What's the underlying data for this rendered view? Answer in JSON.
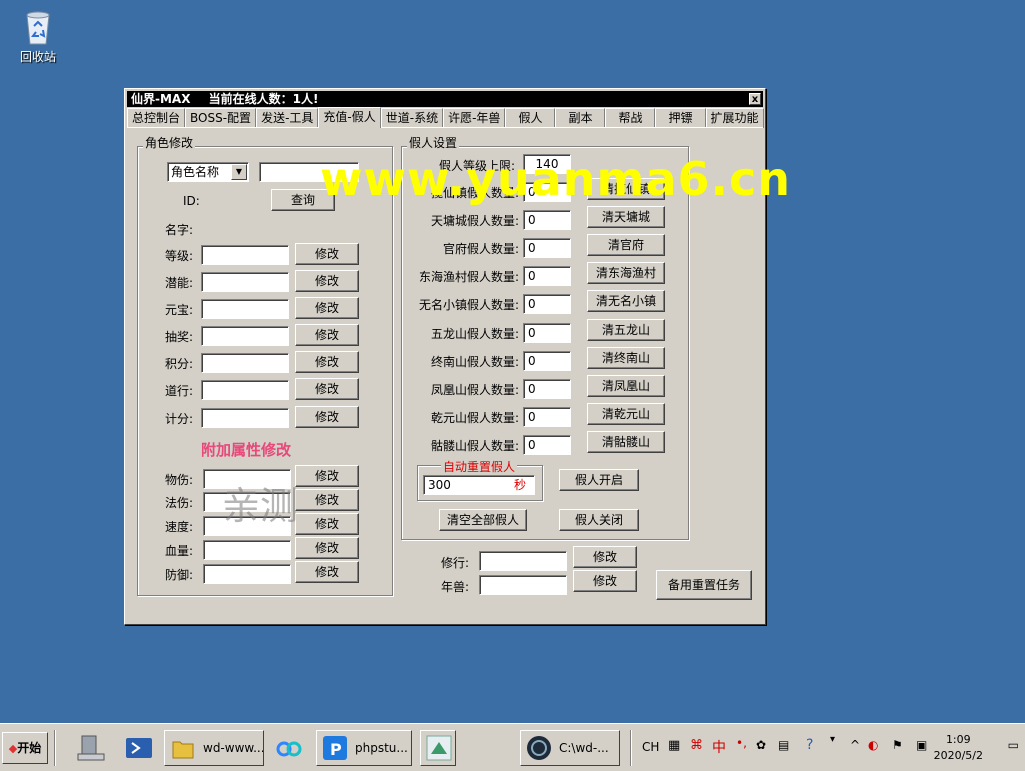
{
  "desktop": {
    "recycle_bin_label": "回收站"
  },
  "window": {
    "title": "仙界-MAX",
    "online_text": "当前在线人数：1人!",
    "close_label": "x",
    "tabs": [
      "总控制台",
      "BOSS-配置",
      "发送-工具",
      "充值-假人",
      "世道-系统",
      "许愿-年兽",
      "假人",
      "副本",
      "帮战",
      "押镖",
      "扩展功能"
    ],
    "active_tab": "充值-假人"
  },
  "role_edit": {
    "title": "角色修改",
    "combo_value": "角色名称",
    "search_value": "",
    "query_label": "查询",
    "id_label": "ID:",
    "name_label": "名字:",
    "rows": [
      {
        "label": "等级:",
        "value": "",
        "button": "修改"
      },
      {
        "label": "潜能:",
        "value": "",
        "button": "修改"
      },
      {
        "label": "元宝:",
        "value": "",
        "button": "修改"
      },
      {
        "label": "抽奖:",
        "value": "",
        "button": "修改"
      },
      {
        "label": "积分:",
        "value": "",
        "button": "修改"
      },
      {
        "label": "道行:",
        "value": "",
        "button": "修改"
      },
      {
        "label": "计分:",
        "value": "",
        "button": "修改"
      }
    ],
    "attr_title": "附加属性修改",
    "attr_rows": [
      {
        "label": "物伤:",
        "value": "",
        "button": "修改"
      },
      {
        "label": "法伤:",
        "value": "",
        "button": "修改"
      },
      {
        "label": "速度:",
        "value": "",
        "button": "修改"
      },
      {
        "label": "血量:",
        "value": "",
        "button": "修改"
      },
      {
        "label": "防御:",
        "value": "",
        "button": "修改"
      }
    ]
  },
  "fake_settings": {
    "title": "假人设置",
    "level_limit_label": "假人等级上限:",
    "level_limit_value": "140",
    "rows": [
      {
        "label": "揽仙镇假人数量:",
        "value": "0",
        "button": "清揽仙镇"
      },
      {
        "label": "天墉城假人数量:",
        "value": "0",
        "button": "清天墉城"
      },
      {
        "label": "官府假人数量:",
        "value": "0",
        "button": "清官府"
      },
      {
        "label": "东海渔村假人数量:",
        "value": "0",
        "button": "清东海渔村"
      },
      {
        "label": "无名小镇假人数量:",
        "value": "0",
        "button": "清无名小镇"
      },
      {
        "label": "五龙山假人数量:",
        "value": "0",
        "button": "清五龙山"
      },
      {
        "label": "终南山假人数量:",
        "value": "0",
        "button": "清终南山"
      },
      {
        "label": "凤凰山假人数量:",
        "value": "0",
        "button": "清凤凰山"
      },
      {
        "label": "乾元山假人数量:",
        "value": "0",
        "button": "清乾元山"
      },
      {
        "label": "骷髅山假人数量:",
        "value": "0",
        "button": "清骷髅山"
      }
    ],
    "auto_reset_title": "自动重置假人",
    "auto_reset_value": "300",
    "auto_reset_unit": "秒",
    "start_label": "假人开启",
    "clear_all_label": "清空全部假人",
    "close_label": "假人关闭"
  },
  "bottom": {
    "xiuxing_label": "修行:",
    "xiuxing_value": "",
    "xiuxing_button": "修改",
    "nianshou_label": "年兽:",
    "nianshou_value": "",
    "nianshou_button": "修改",
    "backup_button": "备用重置任务"
  },
  "watermark": {
    "site": "www.yuanma6.cn",
    "tested": "亲测"
  },
  "taskbar": {
    "start_label": "开始",
    "items": [
      {
        "label": "wd-www..."
      },
      {
        "label": "phpstu..."
      },
      {
        "label": "C:\\wd-..."
      }
    ],
    "lang": "CH",
    "ime": "中",
    "time": "1:09",
    "date": "2020/5/2"
  }
}
